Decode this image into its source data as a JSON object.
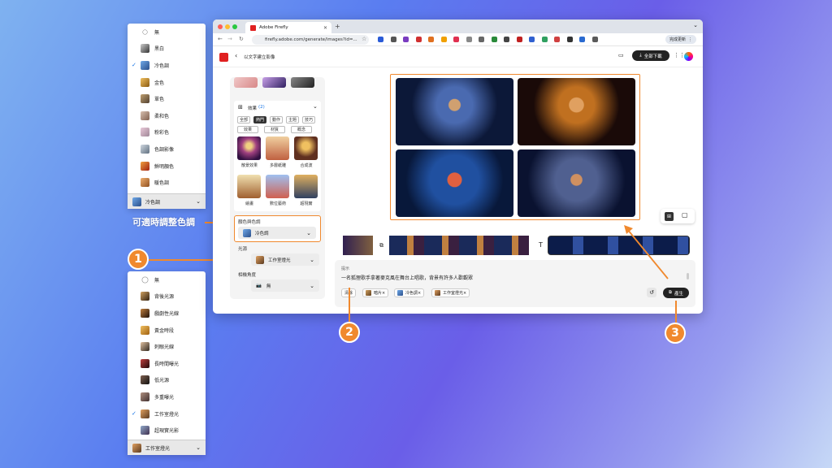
{
  "colour_menu": {
    "items": [
      {
        "label": "無",
        "checked": false
      },
      {
        "label": "黑白",
        "checked": false
      },
      {
        "label": "冷色調",
        "checked": true
      },
      {
        "label": "金色",
        "checked": false
      },
      {
        "label": "單色",
        "checked": false
      },
      {
        "label": "柔和色",
        "checked": false
      },
      {
        "label": "粉彩色",
        "checked": false
      },
      {
        "label": "色調影像",
        "checked": false
      },
      {
        "label": "鮮明顏色",
        "checked": false
      },
      {
        "label": "暖色調",
        "checked": false
      }
    ],
    "selected": "冷色調"
  },
  "light_menu": {
    "items": [
      {
        "label": "無",
        "checked": false
      },
      {
        "label": "背後光源",
        "checked": false
      },
      {
        "label": "戲劇性光線",
        "checked": false
      },
      {
        "label": "黃金時段",
        "checked": false
      },
      {
        "label": "刺眼光線",
        "checked": false
      },
      {
        "label": "長時間曝光",
        "checked": false
      },
      {
        "label": "低光源",
        "checked": false
      },
      {
        "label": "多重曝光",
        "checked": false
      },
      {
        "label": "工作室燈光",
        "checked": true
      },
      {
        "label": "超現實光影",
        "checked": false
      }
    ],
    "selected": "工作室燈光"
  },
  "annotations": {
    "tone_note": "可適時調整色調",
    "callout_1": "1",
    "callout_2": "2",
    "callout_3": "3",
    "accent": "#f0892e"
  },
  "browser": {
    "tab_title": "Adobe Firefly",
    "url": "firefly.adobe.com/generate/images?id=...",
    "update_button": "完成更新"
  },
  "app": {
    "back_label": "以文字建立影像",
    "download_all": "全部下載"
  },
  "effects": {
    "title": "效果",
    "count": "(2)",
    "filters": [
      "全部",
      "熱門",
      "動作",
      "主題",
      "技巧",
      "效果",
      "材質",
      "概念"
    ],
    "active_filter": "熱門",
    "items": [
      "散景效果",
      "多層紙雕",
      "合成波",
      "繪畫",
      "數位藝術",
      "超現實"
    ]
  },
  "colour_tone": {
    "label": "顏色與色調",
    "value": "冷色調"
  },
  "lighting": {
    "label": "光源",
    "value": "工作室燈光"
  },
  "camera": {
    "label": "相機角度",
    "value": "無"
  },
  "prompt": {
    "label": "提示",
    "text": "一名狐狸歌手拿著麥克風在舞台上唱歌，背景有許多人歡觀眾",
    "clear": "清除",
    "tags": [
      "暗片",
      "冷色調",
      "工作室燈光"
    ],
    "generate": "產生"
  }
}
